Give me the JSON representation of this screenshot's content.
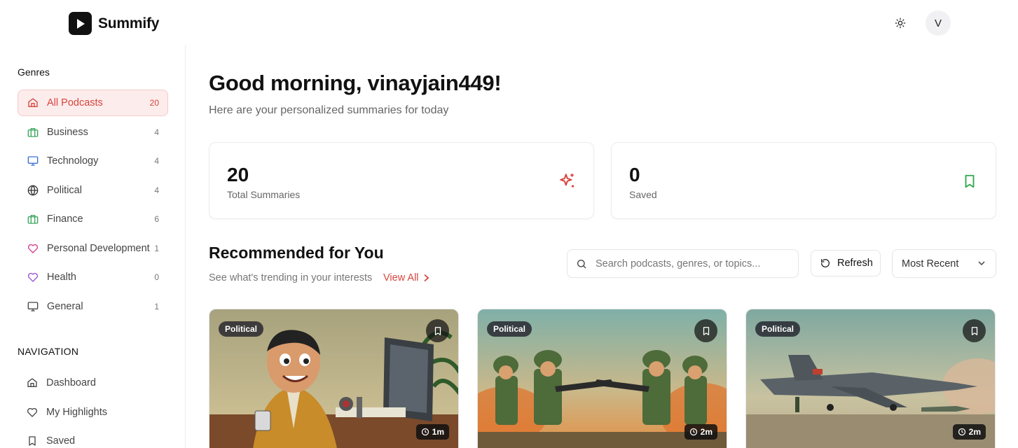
{
  "app": {
    "name": "Summify"
  },
  "header": {
    "avatar_initial": "V"
  },
  "sidebar": {
    "genres_heading": "Genres",
    "genres": [
      {
        "label": "All Podcasts",
        "count": "20",
        "icon": "home-icon",
        "active": true
      },
      {
        "label": "Business",
        "count": "4",
        "icon": "briefcase-icon"
      },
      {
        "label": "Technology",
        "count": "4",
        "icon": "monitor-icon"
      },
      {
        "label": "Political",
        "count": "4",
        "icon": "globe-icon"
      },
      {
        "label": "Finance",
        "count": "6",
        "icon": "briefcase-icon"
      },
      {
        "label": "Personal Development",
        "count": "1",
        "icon": "heart-icon"
      },
      {
        "label": "Health",
        "count": "0",
        "icon": "heart-icon"
      },
      {
        "label": "General",
        "count": "1",
        "icon": "monitor-icon"
      }
    ],
    "navigation_heading": "NAVIGATION",
    "navigation": [
      {
        "label": "Dashboard",
        "icon": "home-icon"
      },
      {
        "label": "My Highlights",
        "icon": "heart-icon"
      },
      {
        "label": "Saved",
        "icon": "bookmark-icon"
      }
    ]
  },
  "main": {
    "greeting": "Good morning, vinayjain449!",
    "subgreeting": "Here are your personalized summaries for today",
    "stats": [
      {
        "value": "20",
        "label": "Total Summaries",
        "icon": "sparkles-icon"
      },
      {
        "value": "0",
        "label": "Saved",
        "icon": "bookmark-icon"
      }
    ],
    "recommended": {
      "title": "Recommended for You",
      "subtitle": "See what's trending in your interests",
      "view_all": "View All"
    },
    "search": {
      "placeholder": "Search podcasts, genres, or topics..."
    },
    "refresh_label": "Refresh",
    "sort": {
      "selected": "Most Recent"
    },
    "podcasts": [
      {
        "genre": "Political",
        "duration": "1m"
      },
      {
        "genre": "Political",
        "duration": "2m"
      },
      {
        "genre": "Political",
        "duration": "2m"
      }
    ]
  },
  "colors": {
    "accent": "#d6453d",
    "active_bg": "#fdecec",
    "business_icon": "#3aa55d",
    "technology_icon": "#3b6fd8",
    "personal_icon": "#d63b8f",
    "health_icon": "#9b4fd6",
    "saved_icon": "#2fa84f"
  }
}
